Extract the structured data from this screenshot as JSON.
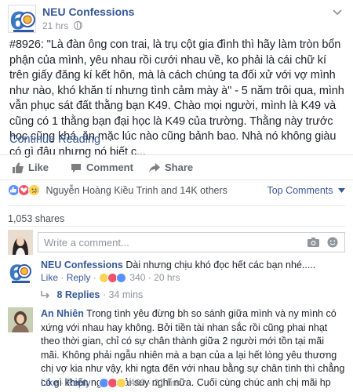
{
  "post": {
    "page_name": "NEU Confessions",
    "time": "21 hrs",
    "text": "#8926: \"Là đàn ông con trai, là trụ cột gia đình thì hãy làm tròn bổn phận của mình, yêu nhau rồi cưới nhau về, ko phải là cái chữ kí trên giấy đăng kí kết hôn, mà là cách chúng ta đối xử với vợ mình như nào, khó khăn tí nhưng tình cảm mày à\" - 5 năm trôi qua, mình vẫn phục sát đất thằng bạn K49. Chào mọi người, mình là K49 và cũng có 1 thằng bạn đại học là K49 của trường. Thằng này trước học cũng khá, ăn mặc lúc nào cũng bảnh bao. Nhà nó không giàu có gì đâu nhưng nó biết c...",
    "continue_label": "Continue Reading"
  },
  "actions": {
    "like": "Like",
    "comment": "Comment",
    "share": "Share"
  },
  "reactions": {
    "summary": "Nguyễn Hoàng Kiều Trinh and 14K others",
    "sort_label": "Top Comments",
    "colors": {
      "like": "#5890ff",
      "love": "#f25268",
      "wow": "#fcd354"
    }
  },
  "shares": "1,053 shares",
  "composer": {
    "placeholder": "Write a comment..."
  },
  "comments": [
    {
      "author": "NEU Confessions",
      "text": "Dài nhưng chịu khó đọc hết các bạn nhé.....",
      "like_label": "Like",
      "reply_label": "Reply",
      "reaction_count": "340",
      "time": "20 hrs"
    },
    {
      "author": "An Nhiên",
      "text": "Trong tình yêu đừng bh so sánh giữa mình và ny mình có xứng với nhau hay không. Bởi tiền tài nhan sắc rồi cũng phai nhạt theo thời gian, chỉ có sự chân thành giữa 2 người mới tồn tại mãi mãi. Không phải ngẫu nhiên mà a bạn của a lại hết lòng yêu thương chị vợ kia như vậy, khi ngta đến với nhau bằng sự chân tình thì chẳng có gì khiến ngta phải suy nghĩ nữa. Cuối cùng chúc anh chị mãi hp",
      "like_label": "Like",
      "reply_label": "Reply",
      "reaction_count": "469",
      "time": "21 hrs"
    }
  ],
  "replies": {
    "label": "8 Replies",
    "time": "34 mins"
  }
}
